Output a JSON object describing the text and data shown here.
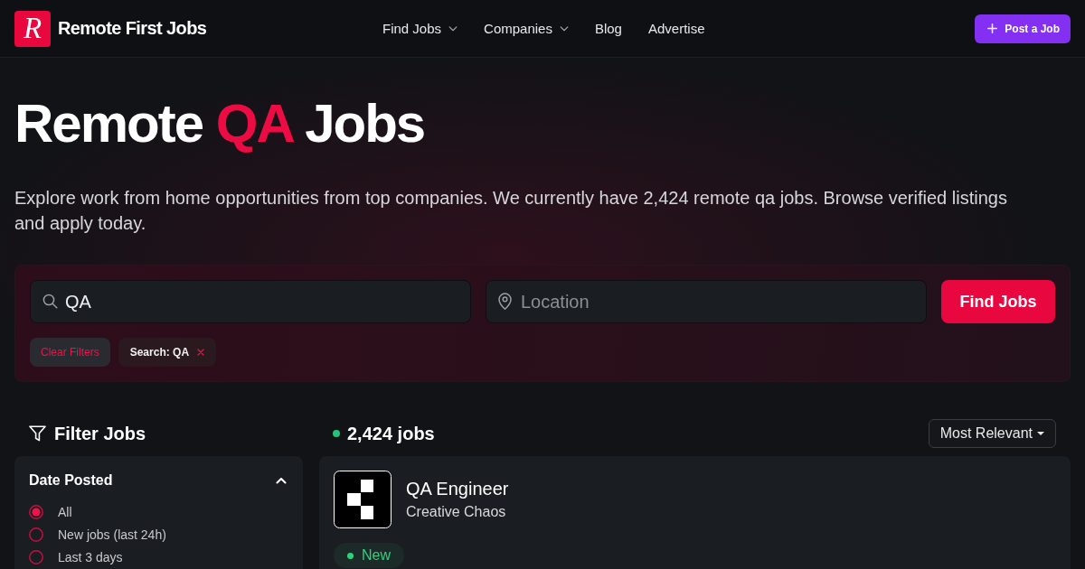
{
  "header": {
    "logo_mark": "R",
    "brand": "Remote First Jobs",
    "nav": [
      {
        "label": "Find Jobs",
        "has_menu": true
      },
      {
        "label": "Companies",
        "has_menu": true
      },
      {
        "label": "Blog",
        "has_menu": false
      },
      {
        "label": "Advertise",
        "has_menu": false
      }
    ],
    "post_button": "Post a Job"
  },
  "hero": {
    "title": [
      {
        "text": "Remote",
        "highlight": false
      },
      {
        "text": "QA",
        "highlight": true
      },
      {
        "text": "Jobs",
        "highlight": false
      }
    ],
    "description": "Explore work from home opportunities from top companies. We currently have 2,424 remote qa jobs. Browse verified listings and apply today."
  },
  "search": {
    "query": {
      "value": "QA"
    },
    "location": {
      "placeholder": "Location"
    },
    "submit": "Find Jobs",
    "filters": [
      {
        "kind": "clear",
        "label": "Clear Filters"
      },
      {
        "kind": "chip",
        "label": "Search: QA"
      }
    ]
  },
  "filter_panel": {
    "title": "Filter Jobs",
    "sections": [
      {
        "title": "Date Posted",
        "expanded": true,
        "options": [
          {
            "label": "All",
            "selected": true
          },
          {
            "label": "New jobs (last 24h)",
            "selected": false
          },
          {
            "label": "Last 3 days",
            "selected": false
          }
        ]
      }
    ]
  },
  "results": {
    "count": "2,424 jobs",
    "sort": "Most Relevant",
    "jobs": [
      {
        "title": "QA Engineer",
        "company": "Creative Chaos",
        "tags": [
          "New"
        ]
      }
    ]
  }
}
